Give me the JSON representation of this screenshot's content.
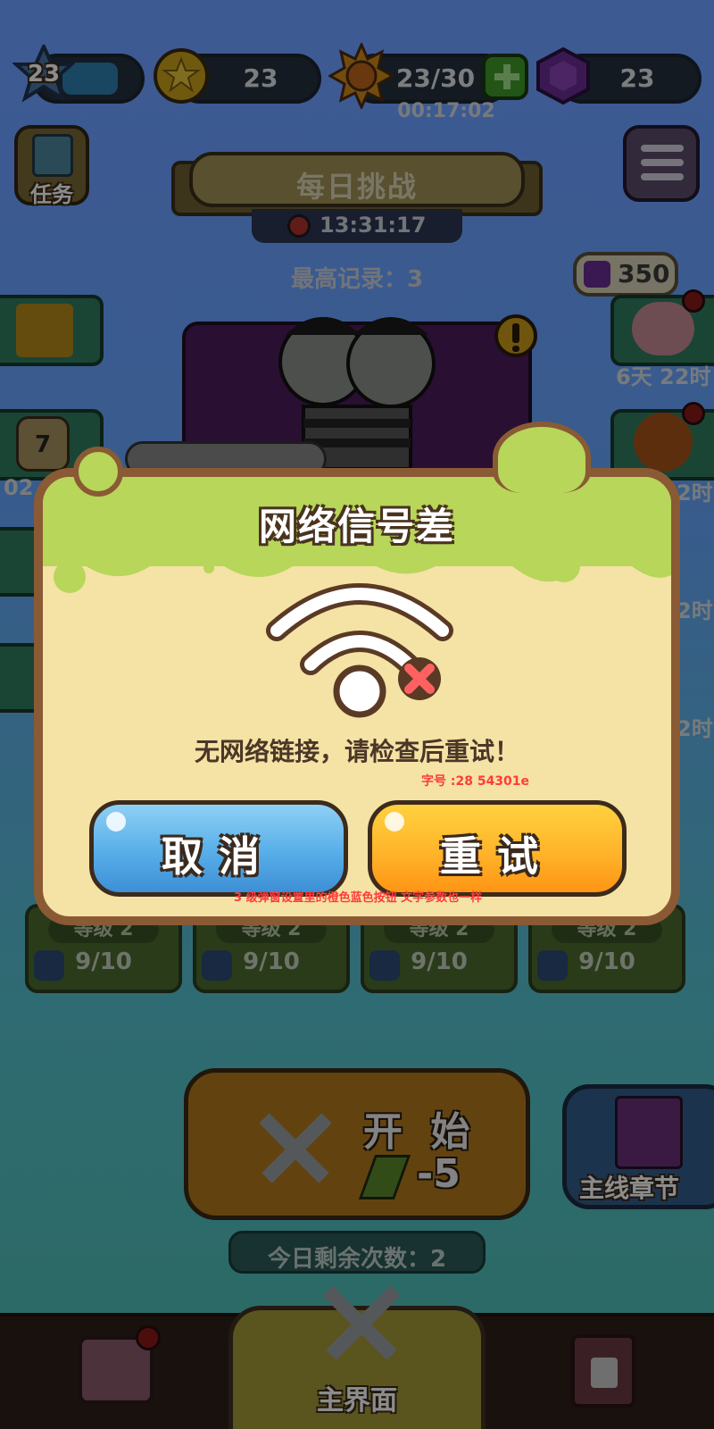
{
  "top_bar": {
    "player_level": "23",
    "coins": "23",
    "energy": "23/30",
    "energy_timer": "00:17:02",
    "gems": "23",
    "add_icon": "plus-icon",
    "xp_progress": 0.7
  },
  "task_button": {
    "label": "任务"
  },
  "challenge": {
    "title": "每日挑战",
    "timer": "13:31:17",
    "best_record": "最高记录：3"
  },
  "side_right": {
    "piggy_gems": "350",
    "piggy_timer": "6天 22时",
    "pumpkin_timer": "2时",
    "leaf_timer": "2时",
    "gift_timer": "2时"
  },
  "side_left": {
    "calendar_day": "7",
    "calendar_timer": "02"
  },
  "cards": [
    {
      "level": "等级 2",
      "progress": "9/10"
    },
    {
      "level": "等级 2",
      "progress": "9/10"
    },
    {
      "level": "等级 2",
      "progress": "9/10"
    },
    {
      "level": "等级 2",
      "progress": "9/10"
    }
  ],
  "start_button": {
    "label": "开 始",
    "cost": "-5"
  },
  "chapter_button": {
    "label": "主线章节"
  },
  "remaining": "今日剩余次数：2",
  "bottom_nav": {
    "center_label": "主界面"
  },
  "dialog": {
    "title": "网络信号差",
    "message": "无网络链接，请检查后重试！",
    "font_annotation": "字号 :28 54301e",
    "button_annotation": "3 级弹窗设置里的橙色蓝色按钮 文字参数也一样",
    "cancel_label": "取消",
    "retry_label": "重试",
    "icon": "wifi-off-icon"
  },
  "colors": {
    "dialog_bg": "#f5e2a5",
    "dialog_border": "#8a5a34",
    "slime_green": "#b7d65a",
    "cancel_blue": "#57aee8",
    "retry_orange": "#ffb42a",
    "annotation_red": "#ff3b3b"
  }
}
